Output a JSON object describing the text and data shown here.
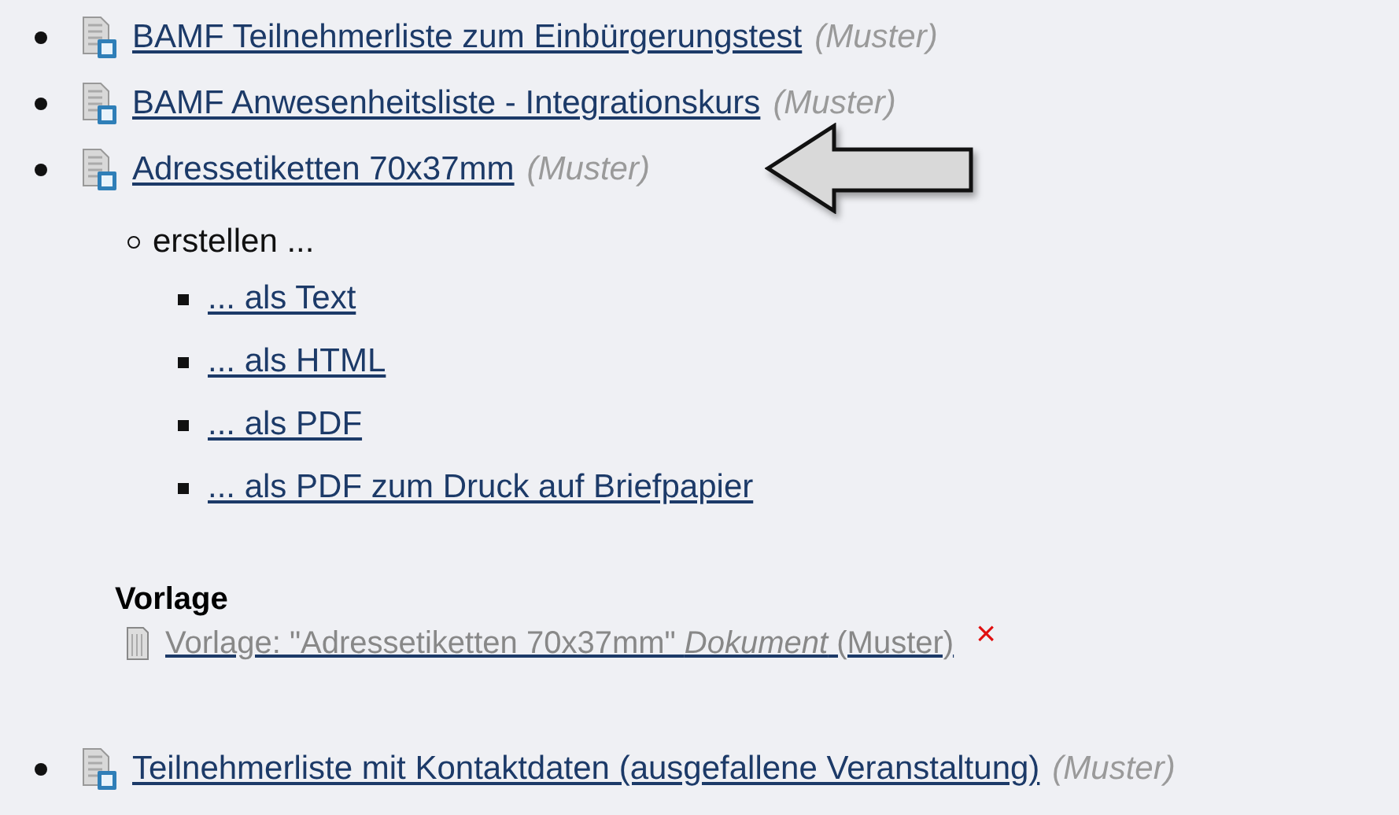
{
  "items": [
    {
      "title": "BAMF Teilnehmerliste zum Einbürgerungstest",
      "note": "(Muster)",
      "pointed": false
    },
    {
      "title": "BAMF Anwesenheitsliste - Integrationskurs",
      "note": "(Muster)",
      "pointed": false
    },
    {
      "title": "Adressetiketten 70x37mm",
      "note": "(Muster)",
      "pointed": true,
      "sub": {
        "label": "erstellen ...",
        "links": [
          "... als Text",
          "... als HTML",
          "... als PDF",
          "... als PDF zum Druck auf Briefpapier"
        ]
      },
      "template": {
        "heading": "Vorlage",
        "link": "Vorlage: \"Adressetiketten 70x37mm\" *Dokument* (Muster)",
        "delete": "×"
      }
    },
    {
      "title": "Teilnehmerliste mit Kontaktdaten (ausgefallene Veranstaltung)",
      "note": "(Muster)",
      "pointed": false
    }
  ]
}
